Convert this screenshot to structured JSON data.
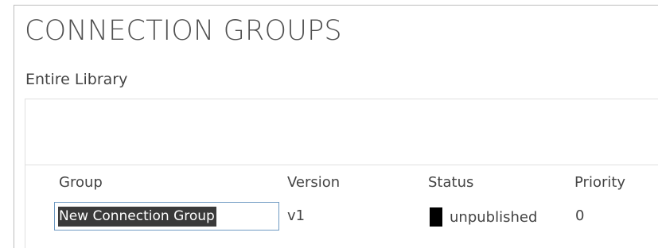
{
  "header": {
    "title": "CONNECTION GROUPS",
    "scope": "Entire Library"
  },
  "table": {
    "columns": [
      "Group",
      "Version",
      "Status",
      "Priority"
    ],
    "rows": [
      {
        "group": "New Connection Group",
        "version": "v1",
        "status": "unpublished",
        "priority": "0"
      }
    ]
  },
  "colors": {
    "status_indicator": "#000000",
    "input_border": "#6f9ac2",
    "selection_bg": "#3a3a3a"
  },
  "icons": {
    "status": "status-square-icon"
  }
}
